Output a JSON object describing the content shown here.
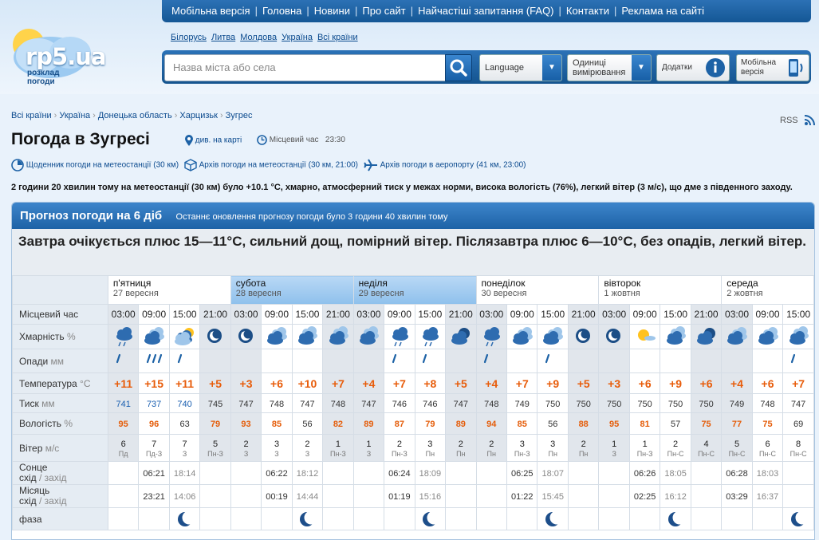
{
  "header": {
    "logo": {
      "main": "rp5.ua",
      "sub1": "розклад",
      "sub2": "погоди"
    },
    "nav": [
      "Мобільна версія",
      "Головна",
      "Новини",
      "Про сайт",
      "Найчастіші запитання (FAQ)",
      "Контакти",
      "Реклама на сайті"
    ],
    "countries": [
      "Білорусь",
      "Литва",
      "Молдова",
      "Україна",
      "Всі країни"
    ],
    "search_placeholder": "Назва міста або села",
    "language_label": "Language",
    "units_label1": "Одиниці",
    "units_label2": "вимірювання",
    "addons_label": "Додатки",
    "mobile_label1": "Мобільна",
    "mobile_label2": "версія"
  },
  "breadcrumbs": [
    "Всі країни",
    "Україна",
    "Донецька область",
    "Харцизьк",
    "Зугрес"
  ],
  "rss": "RSS",
  "page_title": "Погода в Зугресі",
  "map_link": "див. на карті",
  "local_time_label": "Місцевий час",
  "local_time_value": "23:30",
  "archives": {
    "diary": "Щоденник погоди на метеостанції (30 км)",
    "station": "Архів погоди на метеостанції (30 км, 21:00)",
    "airport": "Архів погоди в аеропорту (41 км, 23:00)"
  },
  "observation": "2 години 20 хвилин тому на метеостанції (30 км) було +10.1 °C, хмарно, атмосферний тиск у межах норми, висока вологість (76%), легкий вітер (3 м/с), що дме з південного заходу.",
  "forecast": {
    "heading": "Прогноз погоди на 6 діб",
    "updated": "Останнє оновлення прогнозу погоди було 3 години 40 хвилин тому",
    "summary": "Завтра очікується плюс 15—11°C, сильний дощ, помірний вітер. Післязавтра плюс 6—10°C, без опадів, легкий вітер.",
    "labels": {
      "time": "Місцевий час",
      "clouds": "Хмарність",
      "clouds_unit": "%",
      "precip": "Опади",
      "precip_unit": "мм",
      "temp": "Температура",
      "temp_unit": "°C",
      "pressure": "Тиск",
      "pressure_unit": "мм",
      "humidity": "Вологість",
      "humidity_unit": "%",
      "wind": "Вітер",
      "wind_unit": "м/с",
      "sun": "Сонце",
      "sun_sub1": "схід",
      "sun_sub2": "захід",
      "moon": "Місяць",
      "moon_sub1": "схід",
      "moon_sub2": "захід",
      "phase": "фаза"
    },
    "days": [
      {
        "name": "п'ятниця",
        "date": "27 вересня",
        "times": [
          "03:00",
          "09:00",
          "15:00",
          "21:00"
        ],
        "icons": [
          "cloud-rain-icon",
          "partly-cloudy-icon",
          "partly-sunny-icon",
          "moon-icon"
        ],
        "precip": [
          1,
          3,
          1,
          0
        ],
        "temps": [
          "+11",
          "+15",
          "+11",
          "+5"
        ],
        "pressure": [
          "741",
          "737",
          "740",
          "745"
        ],
        "humidity": [
          "95",
          "96",
          "63",
          "79"
        ],
        "hum_hl": [
          true,
          true,
          false,
          true
        ],
        "wind": [
          "6",
          "7",
          "7",
          "5"
        ],
        "wdir": [
          "Пд",
          "Пд-З",
          "З",
          "Пн-З"
        ],
        "sunrise": "06:21",
        "sunset": "18:14",
        "moonrise": "23:21",
        "moonset": "14:06"
      },
      {
        "name": "субота",
        "date": "28 вересня",
        "times": [
          "03:00",
          "09:00",
          "15:00",
          "21:00"
        ],
        "icons": [
          "moon-icon",
          "partly-cloudy-icon",
          "cloudy-icon",
          "cloudy-icon"
        ],
        "precip": [
          0,
          0,
          0,
          0
        ],
        "temps": [
          "+3",
          "+6",
          "+10",
          "+7"
        ],
        "pressure": [
          "747",
          "748",
          "747",
          "748"
        ],
        "humidity": [
          "93",
          "85",
          "56",
          "82"
        ],
        "hum_hl": [
          true,
          true,
          false,
          true
        ],
        "wind": [
          "2",
          "3",
          "2",
          "1"
        ],
        "wdir": [
          "З",
          "З",
          "З",
          "Пн-З"
        ],
        "sunrise": "06:22",
        "sunset": "18:12",
        "moonrise": "00:19",
        "moonset": "14:44"
      },
      {
        "name": "неділя",
        "date": "29 вересня",
        "times": [
          "03:00",
          "09:00",
          "15:00",
          "21:00"
        ],
        "icons": [
          "cloudy-icon",
          "cloud-rain-icon",
          "cloud-rain-icon",
          "cloud-moon-icon"
        ],
        "precip": [
          0,
          1,
          1,
          0
        ],
        "temps": [
          "+4",
          "+7",
          "+8",
          "+5"
        ],
        "pressure": [
          "747",
          "746",
          "746",
          "747"
        ],
        "humidity": [
          "89",
          "87",
          "79",
          "89"
        ],
        "hum_hl": [
          true,
          true,
          true,
          true
        ],
        "wind": [
          "1",
          "2",
          "3",
          "2"
        ],
        "wdir": [
          "З",
          "Пн-З",
          "Пн",
          "Пн"
        ],
        "sunrise": "06:24",
        "sunset": "18:09",
        "moonrise": "01:19",
        "moonset": "15:16"
      },
      {
        "name": "понеділок",
        "date": "30 вересня",
        "times": [
          "03:00",
          "09:00",
          "15:00",
          "21:00"
        ],
        "icons": [
          "cloud-rain-icon",
          "partly-cloudy-icon",
          "partly-cloudy-icon",
          "moon-icon"
        ],
        "precip": [
          1,
          0,
          1,
          0
        ],
        "temps": [
          "+4",
          "+7",
          "+9",
          "+5"
        ],
        "pressure": [
          "748",
          "749",
          "750",
          "750"
        ],
        "humidity": [
          "94",
          "85",
          "56",
          "88"
        ],
        "hum_hl": [
          true,
          true,
          false,
          true
        ],
        "wind": [
          "2",
          "3",
          "3",
          "2"
        ],
        "wdir": [
          "Пн",
          "Пн-З",
          "Пн",
          "Пн"
        ],
        "sunrise": "06:25",
        "sunset": "18:07",
        "moonrise": "01:22",
        "moonset": "15:45"
      },
      {
        "name": "вівторок",
        "date": "1 жовтня",
        "times": [
          "03:00",
          "09:00",
          "15:00",
          "21:00"
        ],
        "icons": [
          "moon-icon",
          "sunny-icon",
          "cloudy-icon",
          "cloud-moon-icon"
        ],
        "precip": [
          0,
          0,
          0,
          0
        ],
        "temps": [
          "+3",
          "+6",
          "+9",
          "+6"
        ],
        "pressure": [
          "750",
          "750",
          "750",
          "750"
        ],
        "humidity": [
          "95",
          "81",
          "57",
          "75"
        ],
        "hum_hl": [
          true,
          true,
          false,
          true
        ],
        "wind": [
          "1",
          "1",
          "2",
          "4"
        ],
        "wdir": [
          "З",
          "Пн-З",
          "Пн-С",
          "Пн-С"
        ],
        "sunrise": "06:26",
        "sunset": "18:05",
        "moonrise": "02:25",
        "moonset": "16:12"
      },
      {
        "name": "середа",
        "date": "2 жовтня",
        "times": [
          "03:00",
          "09:00",
          "15:00"
        ],
        "icons": [
          "partly-cloudy-icon",
          "partly-cloudy-icon",
          "cloudy-icon"
        ],
        "precip": [
          0,
          0,
          1
        ],
        "temps": [
          "+4",
          "+6",
          "+7"
        ],
        "pressure": [
          "749",
          "748",
          "747"
        ],
        "humidity": [
          "77",
          "75",
          "69"
        ],
        "hum_hl": [
          true,
          true,
          false
        ],
        "wind": [
          "5",
          "6",
          "8"
        ],
        "wdir": [
          "Пн-С",
          "Пн-С",
          "Пн-С"
        ],
        "sunrise": "06:28",
        "sunset": "18:03",
        "moonrise": "03:29",
        "moonset": "16:37"
      }
    ]
  }
}
